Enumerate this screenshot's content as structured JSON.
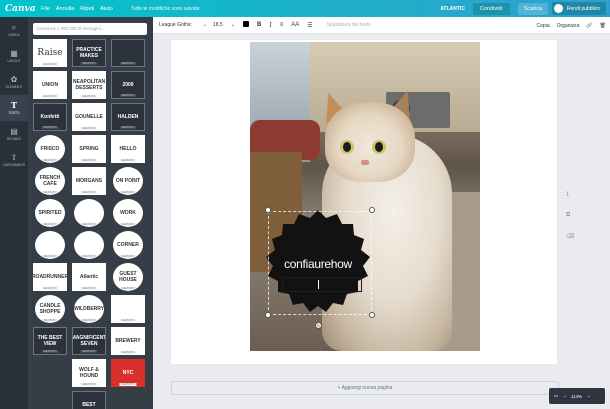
{
  "app": {
    "logo": "Canva",
    "menu": [
      "File",
      "Annulla",
      "Ripeti",
      "Aiuto"
    ],
    "saved_status": "Tutte le modifiche sono salvate",
    "brand": "ATLANTIC",
    "share_label": "Condividi",
    "download_label": "Scarica",
    "public_label": "Rendi pubblico"
  },
  "rail": {
    "items": [
      {
        "label": "CERCA",
        "icon": "search-icon",
        "glyph": "⌕"
      },
      {
        "label": "LAYOUT",
        "icon": "layout-icon",
        "glyph": "▦"
      },
      {
        "label": "ELEMENTI",
        "icon": "elements-icon",
        "glyph": "✿"
      },
      {
        "label": "TESTO",
        "icon": "text-icon",
        "glyph": "T"
      },
      {
        "label": "SFONDO",
        "icon": "background-icon",
        "glyph": "▤"
      },
      {
        "label": "CARICAMENTI",
        "icon": "upload-icon",
        "glyph": "⇪"
      }
    ]
  },
  "panel": {
    "search_placeholder": "Cerca tra 1.000.000 di immagini...",
    "thumb_tag": "GRATUITO",
    "col1": [
      {
        "text": "Raise",
        "style": "big"
      },
      {
        "text": "UNION",
        "style": ""
      },
      {
        "text": "Konfetti",
        "style": "dark"
      },
      {
        "text": "FRISCO",
        "style": "round"
      },
      {
        "text": "FRENCH CAFE",
        "style": "round"
      },
      {
        "text": "SPIRITED",
        "style": "round"
      },
      {
        "text": "",
        "style": "round"
      },
      {
        "text": "ROADRUNNER",
        "style": ""
      },
      {
        "text": "CANDLE SHOPPE",
        "style": "round"
      },
      {
        "text": "THE BEST VIEW",
        "style": "dark"
      }
    ],
    "col2": [
      {
        "text": "PRACTICE MAKES",
        "style": "dark"
      },
      {
        "text": "NEAPOLITAN DESSERTS",
        "style": ""
      },
      {
        "text": "GOUNELLE",
        "style": ""
      },
      {
        "text": "SPRING",
        "style": ""
      },
      {
        "text": "MORGANS",
        "style": ""
      },
      {
        "text": "",
        "style": "round"
      },
      {
        "text": "",
        "style": "round"
      },
      {
        "text": "Atlantic",
        "style": ""
      },
      {
        "text": "WILDBERRY",
        "style": "round"
      },
      {
        "text": "MAGNIFICENT SEVEN",
        "style": "dark"
      },
      {
        "text": "WOLF & HOUND",
        "style": ""
      },
      {
        "text": "BEST",
        "style": "dark"
      }
    ],
    "col3": [
      {
        "text": "",
        "style": "dark"
      },
      {
        "text": "2009",
        "style": "dark"
      },
      {
        "text": "HALDEN",
        "style": "dark"
      },
      {
        "text": "HELLO",
        "style": ""
      },
      {
        "text": "ON POINT",
        "style": "round"
      },
      {
        "text": "WORK",
        "style": "round"
      },
      {
        "text": "CORNER",
        "style": "round"
      },
      {
        "text": "GUEST HOUSE",
        "style": "round"
      },
      {
        "text": "",
        "style": ""
      },
      {
        "text": "BREWERY",
        "style": ""
      },
      {
        "text": "NYC",
        "style": "red"
      }
    ]
  },
  "toolbar": {
    "font": "League Gothic",
    "size": "18,5",
    "bold": "B",
    "italic": "I",
    "case": "AA",
    "spacing": "Spaziatura del testo",
    "copy": "Copia",
    "arrange": "Organizza"
  },
  "canvas": {
    "badge_text": "confiaurehow",
    "page_number": "1",
    "add_page": "+ Aggiungi nuova pagina",
    "zoom": "114%"
  }
}
